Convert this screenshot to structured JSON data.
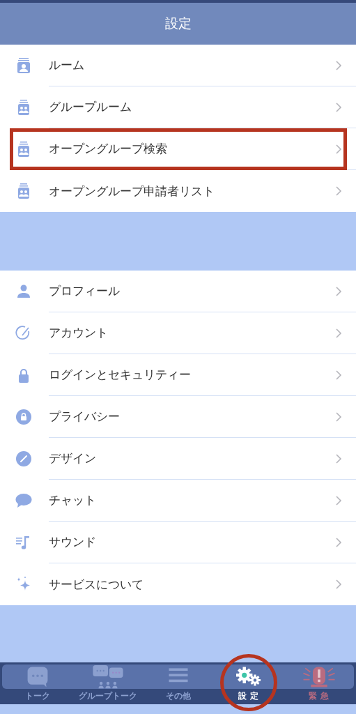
{
  "header": {
    "title": "設定"
  },
  "sections": [
    {
      "items": [
        {
          "label": "ルーム",
          "kind": "room",
          "annotated": false
        },
        {
          "label": "グループルーム",
          "kind": "group",
          "annotated": false
        },
        {
          "label": "オープングループ検索",
          "kind": "group",
          "annotated": true
        },
        {
          "label": "オープングループ申請者リスト",
          "kind": "group",
          "annotated": false
        }
      ]
    },
    {
      "items": [
        {
          "label": "プロフィール",
          "kind": "person",
          "annotated": false
        },
        {
          "label": "アカウント",
          "kind": "account",
          "annotated": false
        },
        {
          "label": "ログインとセキュリティー",
          "kind": "lock",
          "annotated": false
        },
        {
          "label": "プライバシー",
          "kind": "privacy",
          "annotated": false
        },
        {
          "label": "デザイン",
          "kind": "design",
          "annotated": false
        },
        {
          "label": "チャット",
          "kind": "chat",
          "annotated": false
        },
        {
          "label": "サウンド",
          "kind": "sound",
          "annotated": false
        },
        {
          "label": "サービスについて",
          "kind": "sparkle",
          "annotated": false
        }
      ]
    }
  ],
  "tabs": [
    {
      "label": "トーク",
      "kind": "talk",
      "selected": false,
      "annotated": false
    },
    {
      "label": "グループトーク",
      "kind": "grouptalk",
      "selected": false,
      "annotated": false
    },
    {
      "label": "その他",
      "kind": "menu",
      "selected": false,
      "annotated": false
    },
    {
      "label": "設 定",
      "kind": "gears",
      "selected": true,
      "annotated": true
    },
    {
      "label": "緊 急",
      "kind": "alert",
      "selected": false,
      "annotated": false
    }
  ]
}
